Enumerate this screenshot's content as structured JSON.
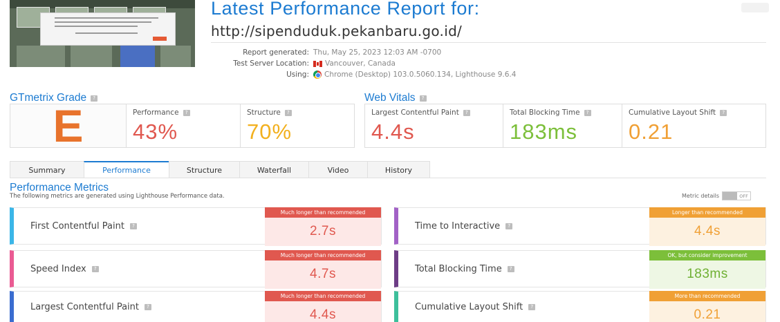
{
  "header": {
    "title": "Latest Performance Report for:",
    "url": "http://sipenduduk.pekanbaru.go.id/",
    "meta": [
      {
        "key": "Report generated:",
        "value": "Thu, May 25, 2023 12:03 AM -0700",
        "icon": ""
      },
      {
        "key": "Test Server Location:",
        "value": "Vancouver, Canada",
        "icon": "canada-flag-icon"
      },
      {
        "key": "Using:",
        "value": "Chrome (Desktop) 103.0.5060.134, Lighthouse 9.6.4",
        "icon": "chrome-icon"
      }
    ]
  },
  "grade": {
    "title": "GTmetrix Grade",
    "help": "?",
    "letter": "E",
    "performance_label": "Performance",
    "performance_value": "43%",
    "structure_label": "Structure",
    "structure_value": "70%"
  },
  "web_vitals": {
    "title": "Web Vitals",
    "help": "?",
    "items": [
      {
        "label": "Largest Contentful Paint",
        "value": "4.4s",
        "color": "#e0584f"
      },
      {
        "label": "Total Blocking Time",
        "value": "183ms",
        "color": "#7cbf3a"
      },
      {
        "label": "Cumulative Layout Shift",
        "value": "0.21",
        "color": "#f0a035"
      }
    ]
  },
  "tabs": [
    "Summary",
    "Performance",
    "Structure",
    "Waterfall",
    "Video",
    "History"
  ],
  "active_tab": "Performance",
  "performance_metrics": {
    "title": "Performance Metrics",
    "subtitle": "The following metrics are generated using Lighthouse Performance data.",
    "details_label": "Metric details",
    "toggle_label": "OFF",
    "items": [
      {
        "name": "First Contentful Paint",
        "badge": "Much longer than recommended",
        "value": "2.7s",
        "status": "bad",
        "accent": "#3bb6e8"
      },
      {
        "name": "Time to Interactive",
        "badge": "Longer than recommended",
        "value": "4.4s",
        "status": "warn",
        "accent": "#a262c6"
      },
      {
        "name": "Speed Index",
        "badge": "Much longer than recommended",
        "value": "4.7s",
        "status": "bad",
        "accent": "#ea5b93"
      },
      {
        "name": "Total Blocking Time",
        "badge": "OK, but consider improvement",
        "value": "183ms",
        "status": "ok",
        "accent": "#6d3d86"
      },
      {
        "name": "Largest Contentful Paint",
        "badge": "Much longer than recommended",
        "value": "4.4s",
        "status": "bad",
        "accent": "#3a6dd0"
      },
      {
        "name": "Cumulative Layout Shift",
        "badge": "More than recommended",
        "value": "0.21",
        "status": "warn",
        "accent": "#3dbf9b"
      }
    ]
  },
  "colors": {
    "brand_blue": "#1c7bd1",
    "grade_orange": "#e8732c",
    "performance_red": "#e0584f",
    "structure_yellow": "#f2b01e"
  }
}
